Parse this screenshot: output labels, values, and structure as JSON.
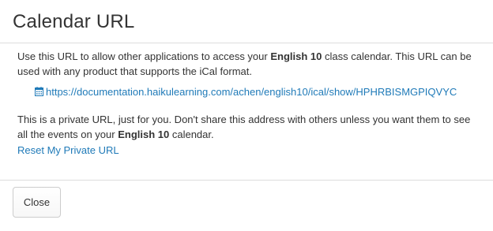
{
  "dialog": {
    "title": "Calendar URL"
  },
  "body": {
    "intro_part1": "Use this URL to allow other applications to access your ",
    "intro_bold": "English 10",
    "intro_part2": " class calendar. This URL can be used with any product that supports the iCal format.",
    "calendar_url": "https://documentation.haikulearning.com/achen/english10/ical/show/HPHRBISMGPIQVYC",
    "calendar_icon": "calendar-icon",
    "private_part1": "This is a private URL, just for you. Don't share this address with others unless you want them to see all the events on your ",
    "private_bold": "English 10",
    "private_part2": " calendar.",
    "reset_link": "Reset My Private URL"
  },
  "footer": {
    "close_label": "Close"
  },
  "colors": {
    "link": "#1f7ab8",
    "text": "#333333",
    "divider": "#dddddd"
  }
}
